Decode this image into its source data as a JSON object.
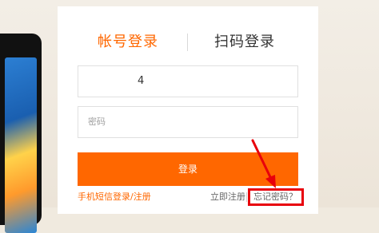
{
  "tabs": {
    "account_login": "帐号登录",
    "qr_login": "扫码登录"
  },
  "form": {
    "account_value": "4",
    "password_placeholder": "密码"
  },
  "buttons": {
    "login": "登录"
  },
  "links": {
    "sms_login": "手机短信登录/注册",
    "register": "立即注册",
    "forgot_password": "忘记密码？"
  },
  "colors": {
    "accent": "#ff6700",
    "highlight": "#e8000b"
  }
}
